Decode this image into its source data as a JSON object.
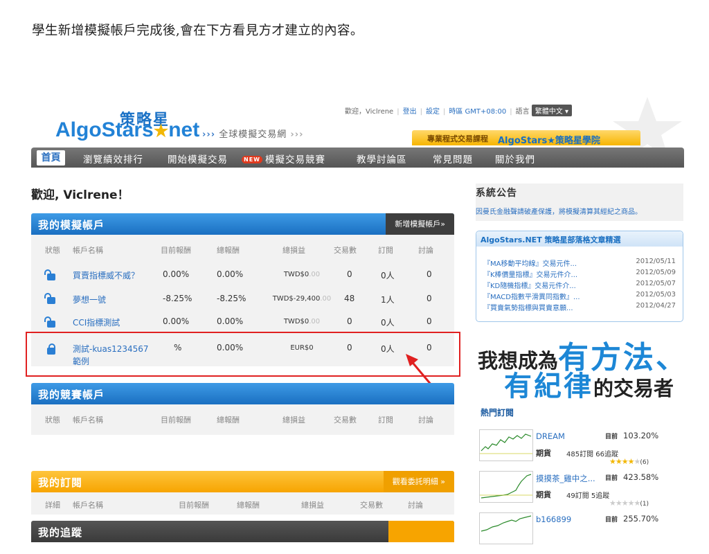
{
  "caption": "學生新增模擬帳戶完成後,會在下方看見方才建立的內容。",
  "header": {
    "logo_cn": "策略星",
    "logo_en_a": "AlgoStars",
    "logo_star": "★",
    "logo_en_b": "net",
    "slogan_arrows1": "›››",
    "slogan": "全球模擬交易網",
    "slogan_arrows2": "›››",
    "welcome_user": "歡迎，Viclrene",
    "logout": "登出",
    "settings": "設定",
    "timezone": "時區 GMT+08:00",
    "language_label": "語言",
    "language_value": "繁體中文",
    "promo_text": "專業程式交易課程",
    "promo_brand": "AlgoStars★策略星學院"
  },
  "nav": {
    "home": "首頁",
    "items": [
      "瀏覽績效排行",
      "開始模擬交易",
      "模擬交易競賽",
      "教學討論區",
      "常見問題",
      "關於我們"
    ],
    "new_badge": "NEW"
  },
  "welcome": "歡迎, Viclrene！",
  "my_accounts": {
    "title": "我的模擬帳戶",
    "button": "新增模擬帳戶»",
    "columns": [
      "狀態",
      "帳戶名稱",
      "目前報酬",
      "總報酬",
      "總損益",
      "交易數",
      "訂閱",
      "討論"
    ],
    "rows": [
      {
        "name": "買賣指標威不威？",
        "current": "0.00%",
        "total": "0.00%",
        "pl_prefix": "TWD$0",
        "pl_dec": ".00",
        "trades": "0",
        "subs": "0人",
        "disc": "0"
      },
      {
        "name": "夢想一號",
        "current": "-8.25%",
        "total": "-8.25%",
        "pl_prefix": "TWD$-29,400",
        "pl_dec": ".00",
        "trades": "48",
        "subs": "1人",
        "disc": "0"
      },
      {
        "name": "CCI指標測試",
        "current": "0.00%",
        "total": "0.00%",
        "pl_prefix": "TWD$0",
        "pl_dec": ".00",
        "trades": "0",
        "subs": "0人",
        "disc": "0"
      },
      {
        "name": "測試-kuas1234567",
        "name2": "範例",
        "current": "%",
        "total": "0.00%",
        "pl_prefix": "EUR$0",
        "pl_dec": "",
        "trades": "0",
        "subs": "0人",
        "disc": "0"
      }
    ]
  },
  "contest_accounts": {
    "title": "我的競賽帳戶",
    "columns": [
      "狀態",
      "帳戶名稱",
      "目前報酬",
      "總報酬",
      "總損益",
      "交易數",
      "訂閱",
      "討論"
    ]
  },
  "subscriptions": {
    "title": "我的訂閱",
    "button": "觀看委託明細 »",
    "columns": [
      "詳細",
      "帳戶名稱",
      "目前報酬",
      "總報酬",
      "總損益",
      "交易數",
      "討論"
    ]
  },
  "bottom_panel": {
    "title": "我的追蹤"
  },
  "sidebar": {
    "notice_title": "系統公告",
    "notice_text": "因曼氏金融聲請破產保護，將模擬清算其經紀之商品。",
    "articles_title": "AlgoStars.NET 策略星部落格文章精選",
    "articles": [
      {
        "title": "『MA移動平均線』交易元件...",
        "date": "2012/05/11"
      },
      {
        "title": "『K棒價量指標』交易元件介...",
        "date": "2012/05/09"
      },
      {
        "title": "『KD隨機指標』交易元件介...",
        "date": "2012/05/07"
      },
      {
        "title": "『MACD指數平滑異同指數』...",
        "date": "2012/05/03"
      },
      {
        "title": "『買賣氣勢指標與買賣意願...",
        "date": "2012/04/27"
      }
    ],
    "banner_a": "我想成為",
    "banner_b": "有方法、",
    "banner_c": "有紀律",
    "banner_d": "的交易者",
    "hot_title": "熱門訂閱",
    "now_label": "目前",
    "hot": [
      {
        "name": "DREAM",
        "value": "103.20%",
        "type": "期貨",
        "subs": "485訂閱 66追蹤",
        "stars": 4,
        "count": "(6)"
      },
      {
        "name": "摸摸茶_雞中之...",
        "value": "423.58%",
        "type": "期貨",
        "subs": "49訂閱 5追蹤",
        "stars": 0,
        "count": "(1)"
      },
      {
        "name": "b166899",
        "value": "255.70%"
      }
    ]
  }
}
